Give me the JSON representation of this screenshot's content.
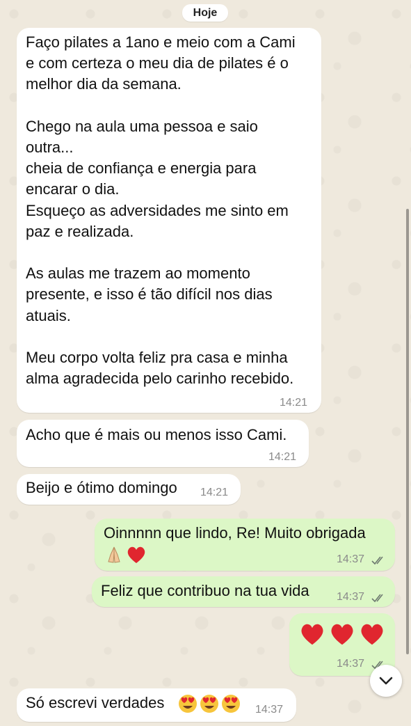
{
  "date_separator": "Hoje",
  "messages": [
    {
      "id": 1,
      "direction": "incoming",
      "text": "Faço pilates a 1ano e meio com a Cami\ne com certeza o meu dia de pilates é o\nmelhor dia da semana.\n\nChego na aula uma pessoa e saio\noutra...\ncheia de confiança e energia para\nencarar o dia.\nEsqueço as adversidades me sinto em\npaz e realizada.\n\nAs aulas me trazem ao momento\npresente, e isso é tão difícil nos dias\natuais.\n\nMeu corpo volta feliz pra casa e minha\nalma agradecida pelo carinho recebido.",
      "time": "14:21"
    },
    {
      "id": 2,
      "direction": "incoming",
      "text": "Acho que é mais ou menos isso Cami.",
      "time": "14:21"
    },
    {
      "id": 3,
      "direction": "incoming",
      "text": "Beijo e ótimo domingo",
      "time": "14:21"
    },
    {
      "id": 4,
      "direction": "outgoing",
      "text": "Oinnnnn que lindo, Re! Muito obrigada",
      "emoji": [
        "folded-hands",
        "red-heart"
      ],
      "time": "14:37",
      "status": "read"
    },
    {
      "id": 5,
      "direction": "outgoing",
      "text": "Feliz que contribuo na tua vida",
      "time": "14:37",
      "status": "read"
    },
    {
      "id": 6,
      "direction": "outgoing",
      "text": "",
      "emoji": [
        "red-heart",
        "red-heart",
        "red-heart"
      ],
      "time": "14:37",
      "status": "read"
    },
    {
      "id": 7,
      "direction": "incoming",
      "text": "Só escrevi verdades",
      "emoji": [
        "heart-eyes",
        "heart-eyes",
        "heart-eyes"
      ],
      "time": "14:37"
    }
  ],
  "scroll_button_icon": "chevron-down-icon",
  "colors": {
    "incoming": "#ffffff",
    "outgoing": "#dcf7c6",
    "background": "#efe9dd",
    "read_ticks": "#6e7a70"
  }
}
